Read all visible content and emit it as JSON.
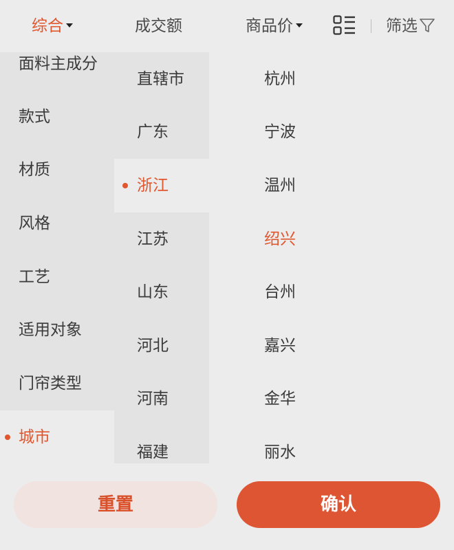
{
  "sortbar": {
    "comprehensive": "综合",
    "turnover": "成交额",
    "price": "商品价",
    "filter": "筛选"
  },
  "categories": [
    {
      "label": "面料主成分",
      "selected": false
    },
    {
      "label": "款式",
      "selected": false
    },
    {
      "label": "材质",
      "selected": false
    },
    {
      "label": "风格",
      "selected": false
    },
    {
      "label": "工艺",
      "selected": false
    },
    {
      "label": "适用对象",
      "selected": false
    },
    {
      "label": "门帘类型",
      "selected": false
    },
    {
      "label": "城市",
      "selected": true
    }
  ],
  "provinces": [
    {
      "label": "直辖市",
      "selected": false
    },
    {
      "label": "广东",
      "selected": false
    },
    {
      "label": "浙江",
      "selected": true
    },
    {
      "label": "江苏",
      "selected": false
    },
    {
      "label": "山东",
      "selected": false
    },
    {
      "label": "河北",
      "selected": false
    },
    {
      "label": "河南",
      "selected": false
    },
    {
      "label": "福建",
      "selected": false
    }
  ],
  "cities": [
    {
      "label": "杭州",
      "selected": false
    },
    {
      "label": "宁波",
      "selected": false
    },
    {
      "label": "温州",
      "selected": false
    },
    {
      "label": "绍兴",
      "selected": true
    },
    {
      "label": "台州",
      "selected": false
    },
    {
      "label": "嘉兴",
      "selected": false
    },
    {
      "label": "金华",
      "selected": false
    },
    {
      "label": "丽水",
      "selected": false
    }
  ],
  "buttons": {
    "reset": "重置",
    "confirm": "确认"
  },
  "colors": {
    "accent": "#e0572f",
    "confirm_bg": "#de5533",
    "reset_bg": "#f1e3df"
  },
  "icons": {
    "layout": "list-grid-icon",
    "filter": "funnel-icon",
    "caret": "caret-down-icon"
  }
}
